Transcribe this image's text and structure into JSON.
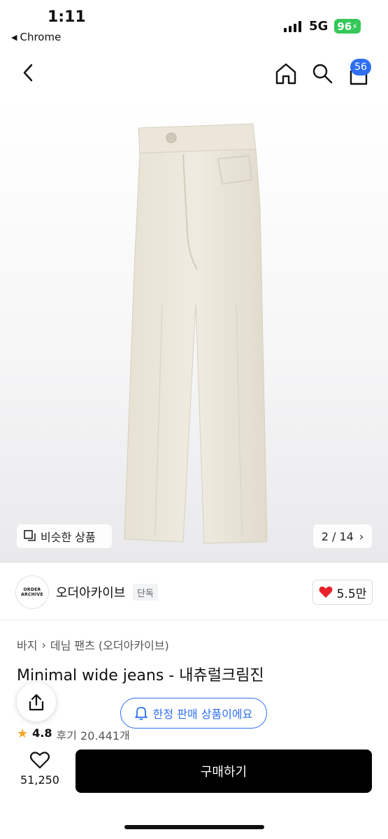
{
  "status_bar": {
    "time": "1:11",
    "back_app": "Chrome",
    "network": "5G",
    "battery": "96"
  },
  "nav": {
    "cart_count": "56",
    "icons": [
      "back-chevron-icon",
      "home-icon",
      "search-icon",
      "cart-icon"
    ]
  },
  "gallery": {
    "similar_label": "비슷한 상품",
    "page_indicator": "2 / 14"
  },
  "brand": {
    "logo_line1": "ORDER",
    "logo_line2": "ARCHIVE",
    "name": "오더아카이브",
    "tag": "단독",
    "likes": "5.5만"
  },
  "breadcrumb": {
    "category": "바지",
    "subcategory": "데님 팬츠 (오더아카이브)"
  },
  "product": {
    "title": "Minimal wide jeans - 내츄럴크림진",
    "limited_notice": "한정 판매 상품이에요",
    "rating": "4.8",
    "reviews": "후기 20,441개"
  },
  "bottom_bar": {
    "wish_count": "51,250",
    "buy_label": "구매하기"
  },
  "colors": {
    "accent_blue": "#2e6ff2",
    "heart_red": "#e8202a",
    "battery_green": "#34c759",
    "star_orange": "#f5a524",
    "buy_button": "#000000"
  }
}
